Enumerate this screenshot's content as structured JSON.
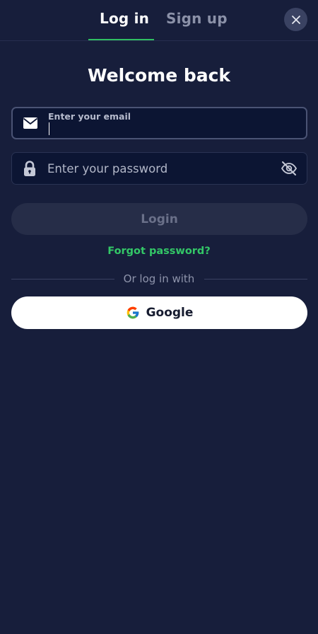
{
  "header": {
    "tabs": [
      {
        "label": "Log in",
        "active": true
      },
      {
        "label": "Sign up",
        "active": false
      }
    ],
    "close_icon": "close-icon",
    "accent_color": "#2fbf62"
  },
  "form": {
    "title": "Welcome back",
    "email": {
      "label": "Enter your email",
      "value": "",
      "icon": "envelope-icon"
    },
    "password": {
      "placeholder": "Enter your password",
      "value": "",
      "icon": "lock-icon",
      "toggle_icon": "eye-off-icon"
    },
    "login_label": "Login",
    "forgot_label": "Forgot password?",
    "divider_label": "Or log in with",
    "google_label": "Google",
    "google_icon": "google-icon"
  },
  "colors": {
    "background": "#171e3b",
    "field_background": "#0c1533",
    "link": "#33c767",
    "disabled_button": "#262d48"
  }
}
